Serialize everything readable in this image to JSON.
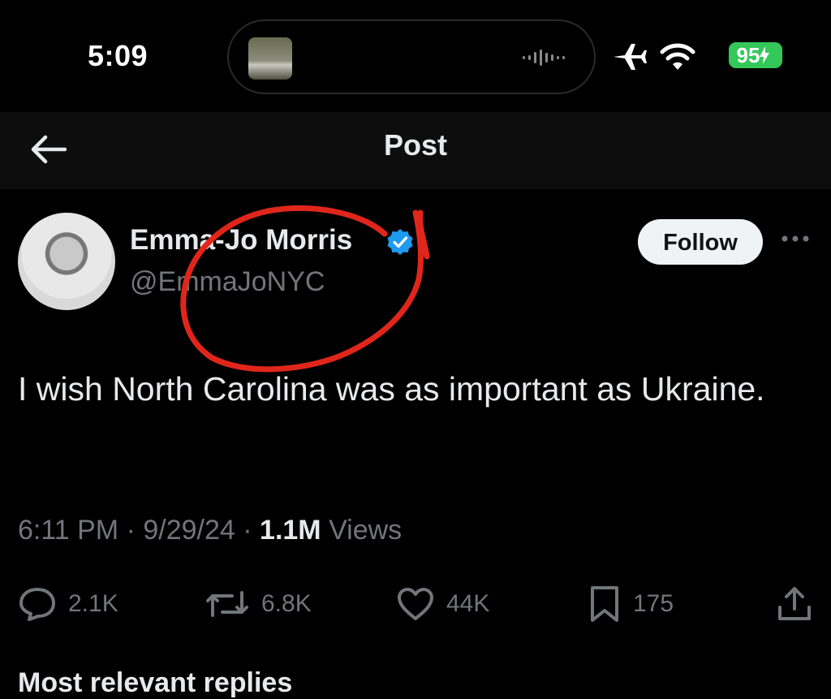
{
  "status_bar": {
    "time": "5:09",
    "battery": "95",
    "icons": [
      "airplane-mode-icon",
      "wifi-icon",
      "battery-charging-icon",
      "voice-waveform-icon"
    ]
  },
  "nav": {
    "title": "Post",
    "back_icon": "back-arrow-icon"
  },
  "post": {
    "author_name": "Emma-Jo Morris",
    "author_handle": "@EmmaJoNYC",
    "follow_label": "Follow",
    "text": "I wish North Carolina was as important as Ukraine.",
    "time": "6:11 PM",
    "date": "9/29/24",
    "views_count": "1.1M",
    "views_label": "Views",
    "stats": {
      "replies": "2.1K",
      "reposts": "6.8K",
      "likes": "44K",
      "bookmarks": "175"
    }
  },
  "peek_text": "Most relevant replies",
  "colors": {
    "background": "#000000",
    "primary_text": "#e7e9ea",
    "secondary_text": "#71767b",
    "verified_blue": "#1d9bf0",
    "battery_green": "#34c759",
    "annotation_red": "#e0261b"
  }
}
